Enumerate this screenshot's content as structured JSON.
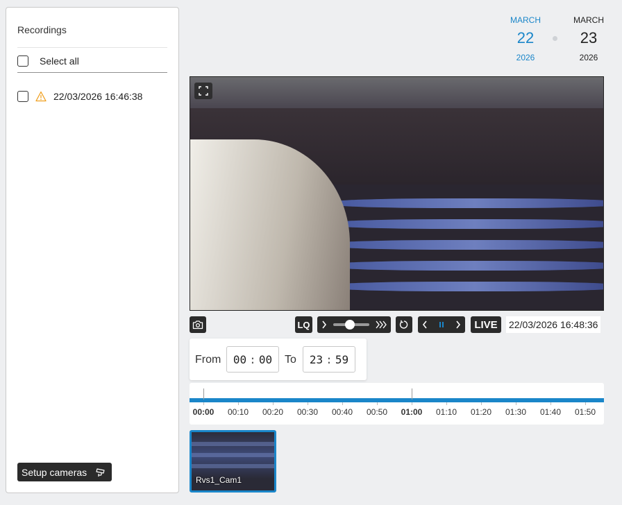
{
  "sidebar": {
    "title": "Recordings",
    "select_all_label": "Select all",
    "recordings": [
      {
        "timestamp": "22/03/2026 16:46:38",
        "status_icon": "warning-icon"
      }
    ],
    "setup_button_label": "Setup cameras",
    "setup_button_icon": "cctv-camera-icon"
  },
  "date_selector": {
    "selected": {
      "month": "MARCH",
      "day": "22",
      "year": "2026"
    },
    "next": {
      "month": "MARCH",
      "day": "23",
      "year": "2026"
    }
  },
  "player": {
    "fullscreen_icon": "fullscreen-icon",
    "quality_label": "LQ",
    "live_label": "LIVE",
    "current_time": "22/03/2026 16:48:36",
    "speed_level": 0.45,
    "state": "paused"
  },
  "time_range": {
    "from_label": "From",
    "to_label": "To",
    "from": {
      "hours": "00",
      "minutes": "00"
    },
    "to": {
      "hours": "23",
      "minutes": "59"
    }
  },
  "timeline": {
    "labels": [
      "00:00",
      "00:10",
      "00:20",
      "00:30",
      "00:40",
      "00:50",
      "01:00",
      "01:10",
      "01:20",
      "01:30",
      "01:40",
      "01:50"
    ],
    "bold_labels": [
      "00:00",
      "01:00"
    ]
  },
  "cameras": [
    {
      "name": "Rvs1_Cam1",
      "selected": true
    }
  ],
  "colors": {
    "accent": "#1a86c9",
    "warning": "#f0a020",
    "control_bg": "#2b2b2b"
  }
}
